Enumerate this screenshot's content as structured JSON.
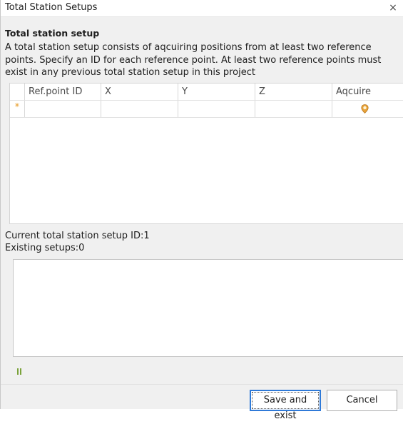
{
  "window": {
    "title": "Total Station Setups",
    "close_glyph": "×"
  },
  "section_title": "Total station setup",
  "description": "A total station setup consists of aqcuiring positions from at least two reference points. Specify an ID for each reference point. At least two reference points must exist in any previous total station setup in this project",
  "grid": {
    "columns": [
      "Ref.point ID",
      "X",
      "Y",
      "Z",
      "Aqcuire"
    ],
    "new_row_marker": "*",
    "new_row": {
      "ref_point_id": "",
      "x": "",
      "y": "",
      "z": "",
      "acquire_icon": "location-pin-icon"
    }
  },
  "status": {
    "current_setup": "Current total station setup ID:1",
    "existing_setups": "Existing setups:0"
  },
  "log_text": "",
  "status_icon": "pause-icon",
  "colors": {
    "accent": "#2f7ad8",
    "row_marker": "#e69a23",
    "pin": "#e8a33a",
    "pause": "#7aa23a"
  },
  "buttons": {
    "save_label": "Save and exist",
    "cancel_label": "Cancel"
  }
}
